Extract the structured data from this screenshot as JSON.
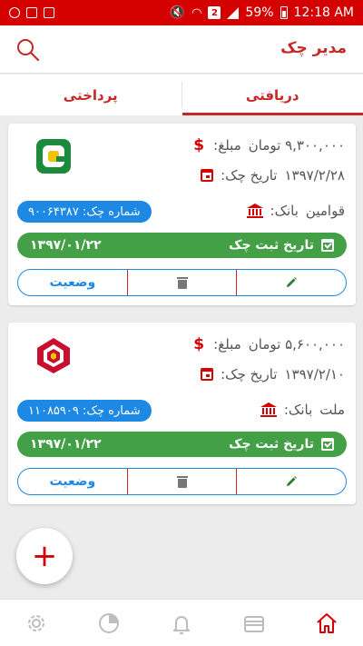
{
  "status_bar": {
    "battery": "59%",
    "time": "12:18 AM",
    "badge": "2"
  },
  "header": {
    "title": "مدیر چک",
    "search_icon": "search-icon"
  },
  "tabs": [
    {
      "label": "دریافتی",
      "active": true
    },
    {
      "label": "پرداختی",
      "active": false
    }
  ],
  "cards": [
    {
      "amount_label": "مبلغ:",
      "amount_value": "۹,۳۰۰,۰۰۰ تومان",
      "date_label": "تاریخ چک:",
      "date_value": "۱۳۹۷/۲/۲۸",
      "bank_label": "بانک:",
      "bank_value": "قوامین",
      "check_number": "شماره چک: ۹۰۰۶۴۳۸۷",
      "register_label": "تاریخ ثبت چک",
      "register_date": "۱۳۹۷/۰۱/۲۲",
      "status_label": "وضعیت",
      "logo_icon": "bank-ghavamin-logo"
    },
    {
      "amount_label": "مبلغ:",
      "amount_value": "۵,۶۰۰,۰۰۰ تومان",
      "date_label": "تاریخ چک:",
      "date_value": "۱۳۹۷/۲/۱۰",
      "bank_label": "بانک:",
      "bank_value": "ملت",
      "check_number": "شماره چک: ۱۱۰۸۵۹۰۹",
      "register_label": "تاریخ ثبت چک",
      "register_date": "۱۳۹۷/۰۱/۲۲",
      "status_label": "وضعیت",
      "logo_icon": "bank-mellat-logo"
    }
  ],
  "fab": {
    "label": "+"
  },
  "colors": {
    "primary": "#d50000",
    "accent_blue": "#1e88e5",
    "green": "#43a047"
  },
  "bottom_nav": [
    {
      "icon": "gear-icon"
    },
    {
      "icon": "pie-chart-icon"
    },
    {
      "icon": "bell-icon"
    },
    {
      "icon": "wallet-icon"
    },
    {
      "icon": "home-icon",
      "active": true
    }
  ]
}
